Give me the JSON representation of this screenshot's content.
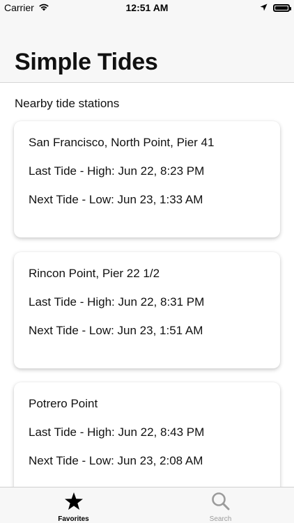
{
  "status_bar": {
    "carrier": "Carrier",
    "time": "12:51 AM",
    "icons": [
      "wifi-icon",
      "location-arrow-icon",
      "battery-icon"
    ],
    "battery_level": 1.0
  },
  "header": {
    "title": "Simple Tides"
  },
  "main": {
    "section_label": "Nearby tide stations",
    "stations": [
      {
        "name": "San Francisco, North Point, Pier 41",
        "last_tide": "Last Tide - High: Jun 22, 8:23 PM",
        "next_tide": "Next Tide - Low: Jun 23, 1:33 AM"
      },
      {
        "name": "Rincon Point, Pier 22 1/2",
        "last_tide": "Last Tide - High: Jun 22, 8:31 PM",
        "next_tide": "Next Tide - Low: Jun 23, 1:51 AM"
      },
      {
        "name": "Potrero Point",
        "last_tide": "Last Tide - High: Jun 22, 8:43 PM",
        "next_tide": "Next Tide - Low: Jun 23, 2:08 AM"
      }
    ]
  },
  "tab_bar": {
    "tabs": [
      {
        "label": "Favorites",
        "icon": "star-icon",
        "active": true
      },
      {
        "label": "Search",
        "icon": "search-icon",
        "active": false
      }
    ],
    "active_color": "#000000",
    "inactive_color": "#9b9b9b"
  }
}
